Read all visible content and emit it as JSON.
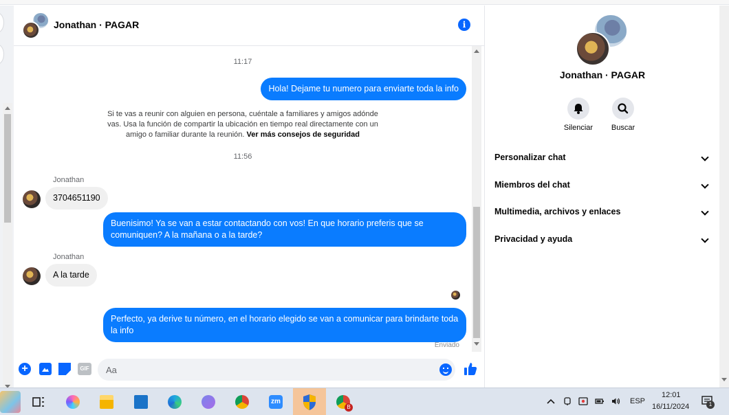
{
  "chat": {
    "title": "Jonathan · PAGAR",
    "timestamps": [
      "11:17",
      "11:56"
    ],
    "messages": [
      {
        "dir": "out",
        "text": "Hola! Dejame tu numero para enviarte toda la info"
      },
      {
        "dir": "in",
        "sender": "Jonathan",
        "text": "3704651190"
      },
      {
        "dir": "out",
        "text": "Buenisimo! Ya se van a estar contactando con vos! En que horario preferis que se comuniquen? A la mañana o a la tarde?"
      },
      {
        "dir": "in",
        "sender": "Jonathan",
        "text": "A la tarde"
      },
      {
        "dir": "out",
        "text": "Perfecto, ya derive tu número, en el horario elegido se van a comunicar para brindarte toda la info"
      }
    ],
    "safety_notice": {
      "text": "Si te vas a reunir con alguien en persona, cuéntale a familiares y amigos adónde vas. Usa la función de compartir la ubicación en tiempo real directamente con un amigo o familiar durante la reunión.",
      "link": "Ver más consejos de seguridad"
    },
    "sent_status": "Enviado"
  },
  "composer": {
    "placeholder": "Aa",
    "gif_label": "GIF"
  },
  "right_panel": {
    "name": "Jonathan · PAGAR",
    "actions": [
      {
        "label": "Silenciar",
        "icon": "bell-icon"
      },
      {
        "label": "Buscar",
        "icon": "search-icon"
      }
    ],
    "sections": [
      "Personalizar chat",
      "Miembros del chat",
      "Multimedia, archivos y enlaces",
      "Privacidad y ayuda"
    ]
  },
  "taskbar": {
    "apps": [
      "widgets-icon",
      "task-view-icon",
      "copilot-icon",
      "file-explorer-icon",
      "mail-icon",
      "edge-icon",
      "teams-icon",
      "chrome-profile-icon",
      "zoom-icon",
      "security-shield-icon",
      "chrome-icon"
    ],
    "zoom_label": "zm",
    "language": "ESP",
    "time": "12:01",
    "date": "16/11/2024",
    "notification_count": "1",
    "chrome_badge": "B"
  },
  "colors": {
    "accent": "#0866ff",
    "bubble_out": "#0a7cff",
    "bubble_in": "#f0f0f0"
  }
}
